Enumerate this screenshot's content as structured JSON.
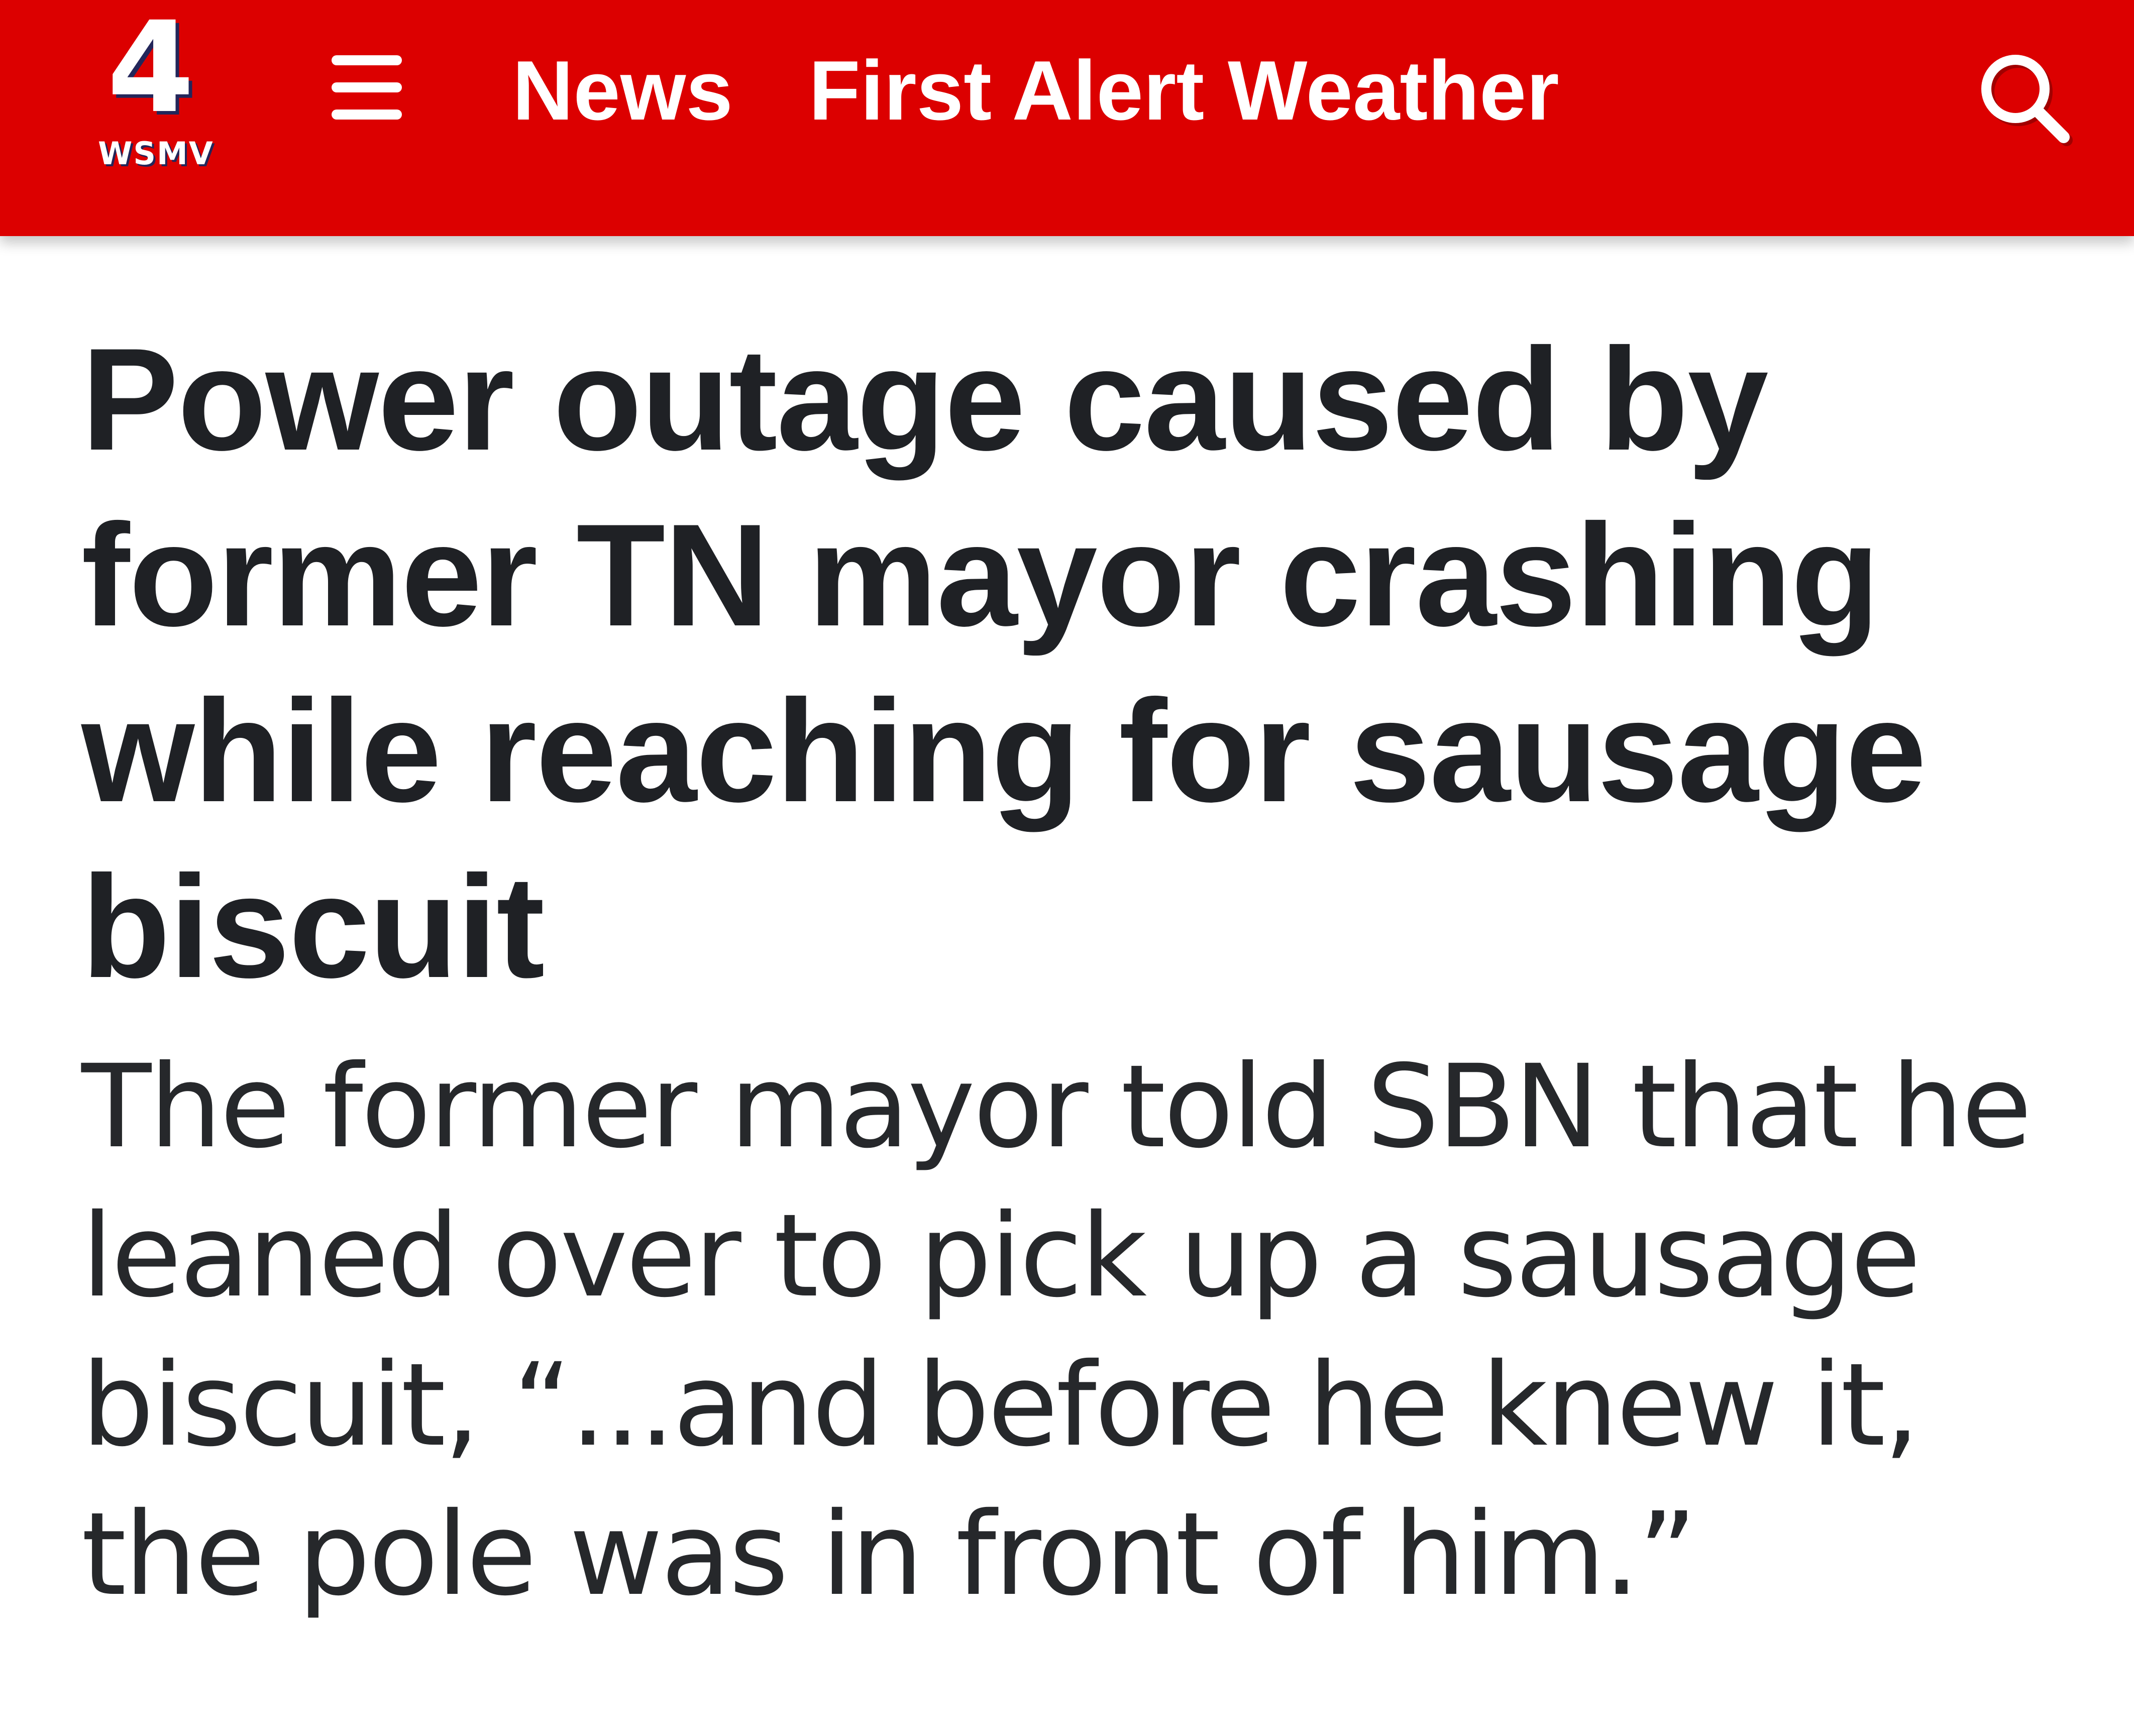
{
  "header": {
    "logo": {
      "number": "4",
      "call_letters": "WSMV"
    },
    "nav": {
      "news_label": "News",
      "weather_label": "First Alert Weather"
    },
    "icons": {
      "menu": "hamburger-menu-icon",
      "search": "search-icon"
    },
    "colors": {
      "header_bg": "#dc0000",
      "logo_shadow": "#23265a"
    }
  },
  "article": {
    "headline": "Power outage caused by former TN mayor crashing while reaching for sausage biscuit",
    "deck": "The former mayor told SBN that he leaned over to pick up a sausage biscuit, “...and before he knew it, the pole was in front of him.”"
  }
}
